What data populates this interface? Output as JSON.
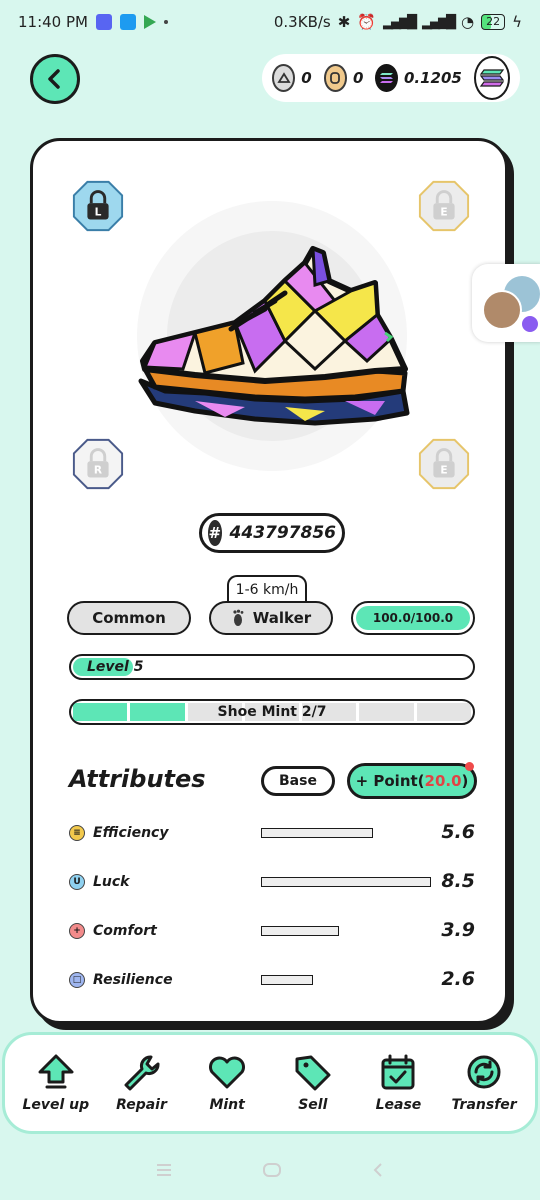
{
  "status_bar": {
    "time": "11:40 PM",
    "network_speed": "0.3KB/s",
    "battery": "22"
  },
  "wallet": {
    "gst_balance": "0",
    "gmt_balance": "0",
    "sol_balance": "0.1205"
  },
  "sneaker": {
    "id": "443797856",
    "speed_range": "1-6 km/h",
    "rarity": "Common",
    "type": "Walker",
    "durability": "100.0/100.0",
    "level": "Level 5",
    "level_progress": 0.15,
    "shoe_mint": "Shoe Mint 2/7",
    "mint_count": 2,
    "mint_total": 7,
    "gem_sockets": [
      {
        "label": "L",
        "state": "locked-blue"
      },
      {
        "label": "E",
        "state": "locked-yellow"
      },
      {
        "label": "R",
        "state": "locked-outline"
      },
      {
        "label": "E",
        "state": "locked-yellow"
      }
    ]
  },
  "attributes": {
    "title": "Attributes",
    "base_label": "Base",
    "point_label": "+ Point(",
    "point_value": "20.0",
    "point_close": ")",
    "items": [
      {
        "name": "Efficiency",
        "value": "5.6",
        "level": 5.6,
        "icon": "efficiency-icon",
        "color": "#f2c94c"
      },
      {
        "name": "Luck",
        "value": "8.5",
        "level": 8.5,
        "icon": "luck-icon",
        "color": "#8fd1f0"
      },
      {
        "name": "Comfort",
        "value": "3.9",
        "level": 3.9,
        "icon": "comfort-icon",
        "color": "#f28b8b"
      },
      {
        "name": "Resilience",
        "value": "2.6",
        "level": 2.6,
        "icon": "resilience-icon",
        "color": "#9fb6f0"
      }
    ]
  },
  "bottom_nav": {
    "items": [
      {
        "label": "Level up",
        "icon": "level-up-icon"
      },
      {
        "label": "Repair",
        "icon": "wrench-icon"
      },
      {
        "label": "Mint",
        "icon": "heart-icon"
      },
      {
        "label": "Sell",
        "icon": "tag-icon"
      },
      {
        "label": "Lease",
        "icon": "calendar-icon"
      },
      {
        "label": "Transfer",
        "icon": "transfer-icon"
      }
    ]
  },
  "colors": {
    "accent": "#5de6b6",
    "background": "#d8f7ee",
    "outline": "#1b1b1b"
  }
}
